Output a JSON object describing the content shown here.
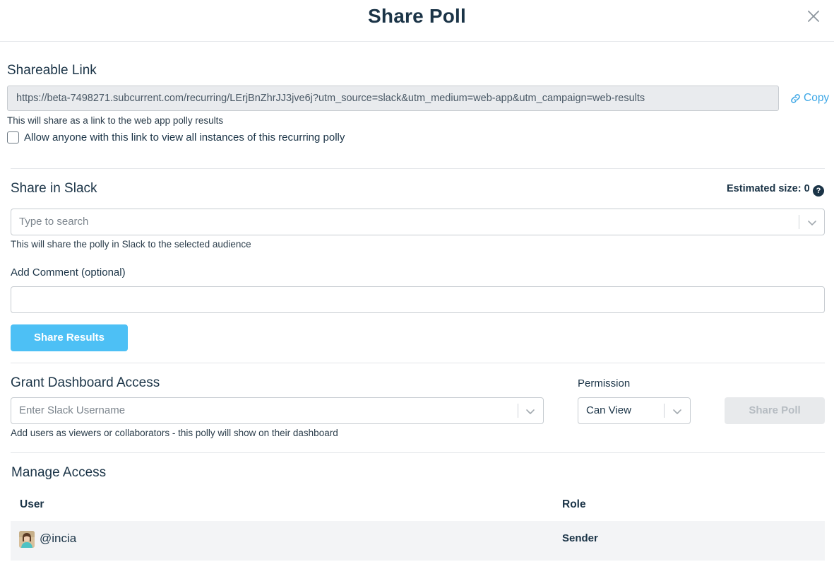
{
  "modal": {
    "title": "Share Poll"
  },
  "shareable_link": {
    "heading": "Shareable Link",
    "url": "https://beta-7498271.subcurrent.com/recurring/LErjBnZhrJJ3jve6j?utm_source=slack&utm_medium=web-app&utm_campaign=web-results",
    "copy_label": "Copy",
    "helper": "This will share as a link to the web app polly results",
    "checkbox_label": "Allow anyone with this link to view all instances of this recurring polly",
    "checkbox_checked": false
  },
  "share_in_slack": {
    "heading": "Share in Slack",
    "estimated_size_label": "Estimated size: 0",
    "search_placeholder": "Type to search",
    "helper": "This will share the polly in Slack to the selected audience",
    "comment_label": "Add Comment (optional)",
    "comment_value": "",
    "share_button_label": "Share Results"
  },
  "dashboard_access": {
    "heading": "Grant Dashboard Access",
    "username_placeholder": "Enter Slack Username",
    "helper": "Add users as viewers or collaborators - this polly will show on their dashboard",
    "permission_label": "Permission",
    "permission_value": "Can View",
    "share_button_label": "Share Poll"
  },
  "manage_access": {
    "heading": "Manage Access",
    "columns": [
      "User",
      "Role"
    ],
    "rows": [
      {
        "user": "@incia",
        "role": "Sender"
      }
    ]
  },
  "colors": {
    "primary_text": "#1b3447",
    "accent_blue": "#4dc0f5",
    "link_blue": "#3da7e6",
    "disabled_bg": "#e8eaec",
    "row_bg": "#f3f4f6"
  },
  "icons": {
    "close": "close-x-icon",
    "copy": "link-chain-icon",
    "help": "question-circle-icon",
    "chevron": "chevron-down-icon",
    "avatar": "user-avatar"
  }
}
